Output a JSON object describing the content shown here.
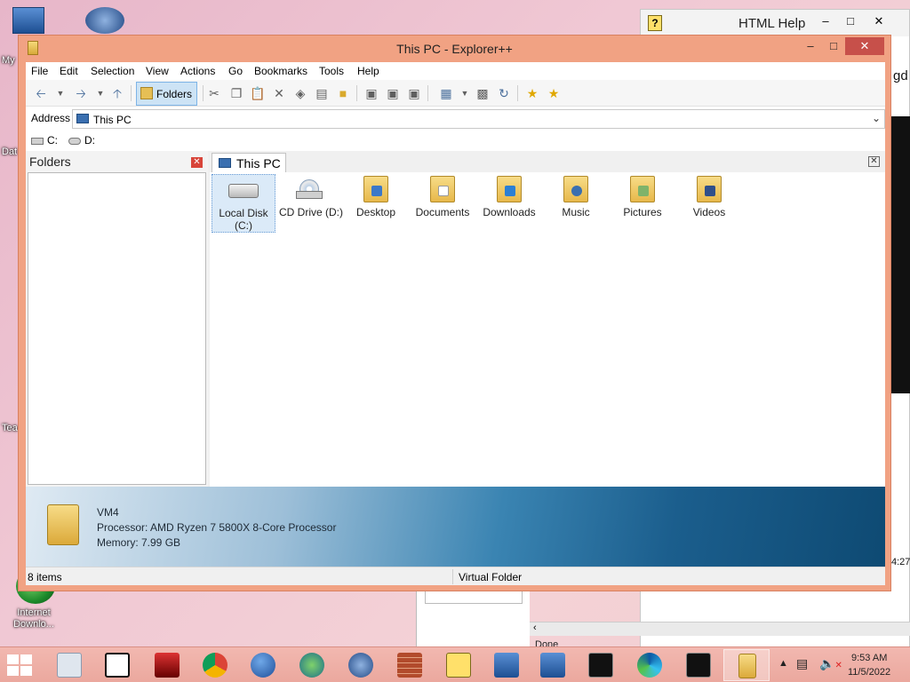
{
  "desktop": {
    "icons": [
      {
        "label": "My"
      },
      {
        "label": "Dat"
      },
      {
        "label": "Tea"
      },
      {
        "label": "Internet\nDownlo..."
      }
    ]
  },
  "help_window": {
    "title": "HTML Help",
    "side_text": "gd",
    "clock_fragment": "4:27",
    "status": "Done"
  },
  "explorer": {
    "title": "This PC - Explorer++",
    "controls": {
      "minimize": "–",
      "maximize": "□",
      "close": "✕"
    },
    "menu": [
      "File",
      "Edit",
      "Selection",
      "View",
      "Actions",
      "Go",
      "Bookmarks",
      "Tools",
      "Help"
    ],
    "toolbar": {
      "folders_label": "Folders",
      "icons": [
        "back-icon",
        "back-dropdown-icon",
        "forward-icon",
        "forward-dropdown-icon",
        "up-icon",
        "cut-icon",
        "copy-icon",
        "paste-icon",
        "delete-icon",
        "delete-permanently-icon",
        "properties-icon",
        "new-folder-icon",
        "copy-to-icon",
        "move-to-icon",
        "go-to-folder-icon",
        "views-icon",
        "views-dropdown-icon",
        "command-prompt-icon",
        "refresh-icon",
        "add-bookmark-icon",
        "bookmarks-icon"
      ]
    },
    "address": {
      "label": "Address",
      "value": "This PC"
    },
    "drives": [
      {
        "label": "C:"
      },
      {
        "label": "D:"
      }
    ],
    "folders_pane": {
      "title": "Folders"
    },
    "tab": {
      "label": "This PC"
    },
    "items": [
      {
        "label": "Local Disk\n(C:)",
        "icon": "local-disk-icon",
        "selected": true
      },
      {
        "label": "CD Drive (D:)",
        "icon": "cd-drive-icon"
      },
      {
        "label": "Desktop",
        "icon": "desktop-folder-icon"
      },
      {
        "label": "Documents",
        "icon": "documents-folder-icon"
      },
      {
        "label": "Downloads",
        "icon": "downloads-folder-icon"
      },
      {
        "label": "Music",
        "icon": "music-folder-icon"
      },
      {
        "label": "Pictures",
        "icon": "pictures-folder-icon"
      },
      {
        "label": "Videos",
        "icon": "videos-folder-icon"
      }
    ],
    "info": {
      "name": "VM4",
      "processor": "Processor: AMD Ryzen 7 5800X 8-Core Processor",
      "memory": "Memory: 7.99 GB"
    },
    "status": {
      "left": "8 items",
      "right": "Virtual Folder"
    }
  },
  "taskbar": {
    "apps": [
      "control-panel-icon",
      "7zip-icon",
      "game-icon",
      "chrome-icon",
      "globe-icon",
      "internet-download-manager-icon",
      "app-icon",
      "firewall-icon",
      "help-icon",
      "computer-icon",
      "computer-icon-2",
      "command-prompt-icon",
      "edge-icon",
      "command-prompt-icon-2",
      "explorer-plus-plus-icon"
    ],
    "time": "9:53 AM",
    "date": "11/5/2022"
  }
}
